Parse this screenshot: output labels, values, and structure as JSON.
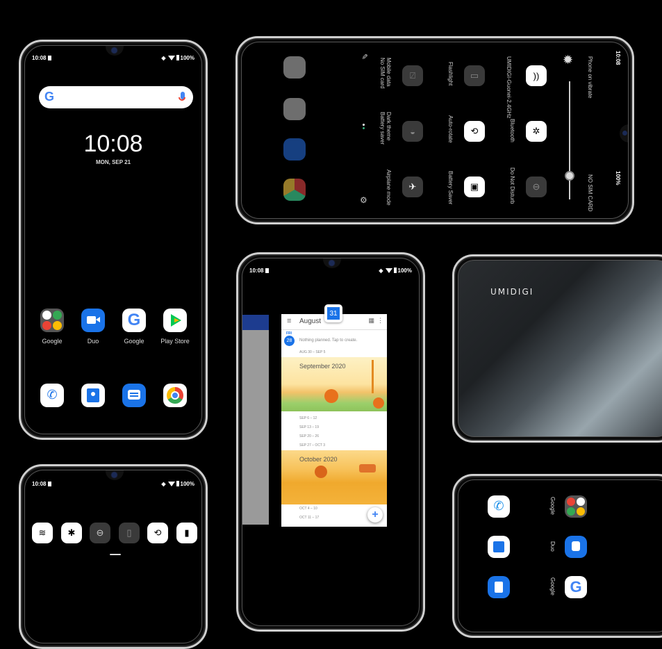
{
  "status_bar": {
    "time": "10:08",
    "battery": "100%"
  },
  "home_screen": {
    "search_icon": "google-g",
    "clock": "10:08",
    "date": "MON, SEP 21",
    "apps_row": [
      {
        "label": "Google",
        "icon": "google-folder-icon"
      },
      {
        "label": "Duo",
        "icon": "duo-icon"
      },
      {
        "label": "Google",
        "icon": "google-icon"
      },
      {
        "label": "Play Store",
        "icon": "play-store-icon"
      }
    ],
    "dock": [
      {
        "icon": "phone-icon"
      },
      {
        "icon": "contacts-icon"
      },
      {
        "icon": "messages-icon"
      },
      {
        "icon": "chrome-icon"
      }
    ]
  },
  "quick_settings_landscape": {
    "header_left": "Phone on vibrate",
    "header_right": "NO SIM CARD",
    "brightness_level": 0.8,
    "tiles": [
      {
        "label": "UMIDIGI-Guonei-2.4GHz",
        "icon": "wifi-icon",
        "state": "on"
      },
      {
        "label": "Bluetooth",
        "icon": "bluetooth-icon",
        "state": "on"
      },
      {
        "label": "Do Not Disturb",
        "icon": "dnd-icon",
        "state": "off"
      },
      {
        "label": "Flashlight",
        "icon": "flashlight-icon",
        "state": "off"
      },
      {
        "label": "Auto-rotate",
        "icon": "rotate-icon",
        "state": "on"
      },
      {
        "label": "Battery Saver",
        "icon": "battery-saver-icon",
        "state": "on"
      },
      {
        "label": "Mobile data\nNo SIM card",
        "icon": "mobile-data-icon",
        "state": "off"
      },
      {
        "label": "Dark theme\nBattery saver",
        "icon": "dark-theme-icon",
        "state": "off"
      },
      {
        "label": "Airplane mode",
        "icon": "airplane-icon",
        "state": "off"
      }
    ]
  },
  "calendar_recents": {
    "app_icon_day": "31",
    "month": "August",
    "day_name": "FRI",
    "day_num": "28",
    "empty_text": "Nothing planned. Tap to create.",
    "weeks_before": [
      "AUG 30 – SEP 5"
    ],
    "september_title": "September 2020",
    "weeks_sep": [
      "SEP 6 – 12",
      "SEP 13 – 19",
      "SEP 20 – 26",
      "SEP 27 – OCT 3"
    ],
    "october_title": "October 2020",
    "weeks_oct": [
      "OCT 4 – 10",
      "OCT 11 – 17"
    ]
  },
  "back_panel": {
    "brand": "UMIDIGI"
  },
  "quick_tiles_row": [
    "wifi-icon",
    "bluetooth-icon",
    "dnd-icon",
    "flashlight-icon",
    "rotate-icon",
    "battery-saver-icon"
  ],
  "home_landscape": {
    "apps": [
      {
        "label": "Google",
        "icon": "google-folder-icon"
      },
      {
        "label": "Duo",
        "icon": "duo-icon"
      },
      {
        "label": "Google",
        "icon": "google-icon"
      }
    ]
  }
}
